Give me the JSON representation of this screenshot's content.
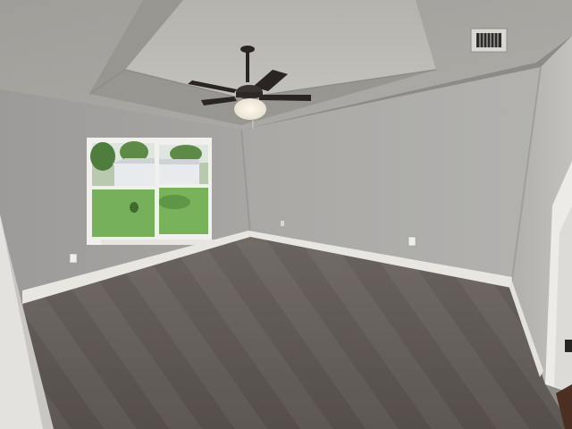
{
  "scene": {
    "subject": "empty-bedroom",
    "elements": [
      "tray-ceiling",
      "ceiling-fan",
      "window",
      "carpet",
      "baseboards",
      "wall-outlets",
      "ceiling-vent",
      "door-frame"
    ]
  },
  "colors": {
    "ceiling": "#a7a6a1",
    "tray_recess": "#b9b8b2",
    "wall_back": "#aeadab",
    "wall_left": "#a3a2a0",
    "wall_right": "#b7b6b3",
    "carpet": "#5e5753",
    "baseboard": "#e8e6e1",
    "fan_blade": "#2a2422",
    "fan_light": "#f4efe2",
    "window_frame": "#f1f0ec",
    "lawn": "#77b05a",
    "sky": "#e6ebe4"
  }
}
